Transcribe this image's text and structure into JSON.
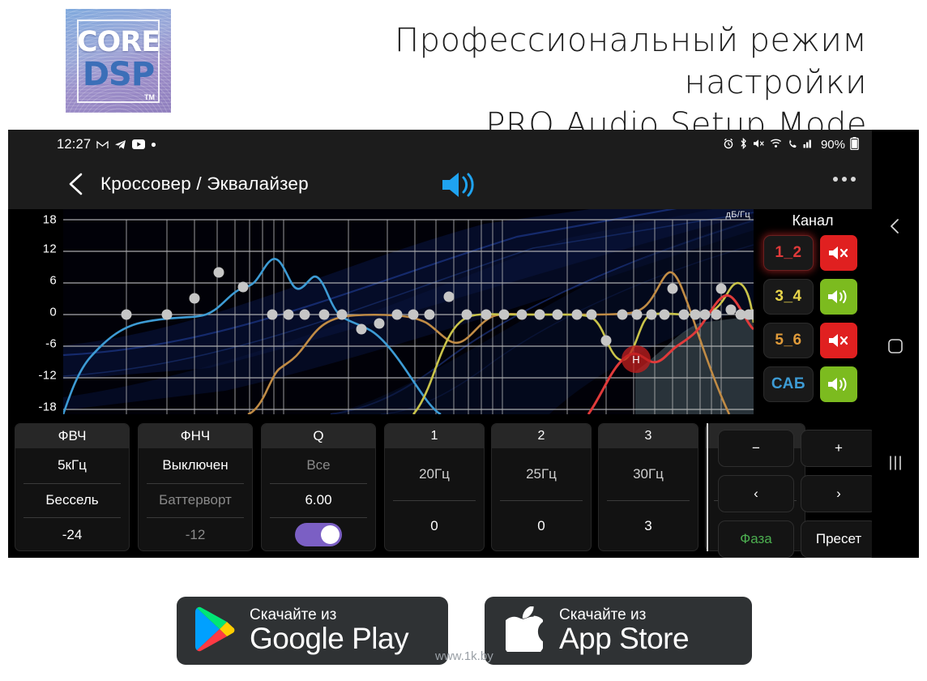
{
  "promo": {
    "logo": {
      "word1": "CORE",
      "word2": "DSP",
      "tm": "TM"
    },
    "title_ru": "Профессиональный режим настройки",
    "title_en": "PRO Audio Setup Mode"
  },
  "status_bar": {
    "clock": "12:27",
    "left_icons": [
      "gmail-icon",
      "telegram-icon",
      "youtube-icon",
      "dot-icon"
    ],
    "right_icons": [
      "alarm-icon",
      "bluetooth-icon",
      "mute-icon",
      "wifi-icon",
      "call-icon",
      "signal-icon"
    ],
    "battery_percent": "90%"
  },
  "title_bar": {
    "back_icon": "chevron-left-icon",
    "title": "Кроссовер / Эквалайзер",
    "speaker_icon": "speaker-on-icon",
    "overflow_icon": "overflow-menu-icon"
  },
  "graph": {
    "unit_label": "дБ/Гц",
    "y_ticks": [
      "18",
      "12",
      "6",
      "0",
      "-6",
      "-12",
      "-18"
    ],
    "marker_label": "H"
  },
  "chart_data": {
    "type": "line",
    "title": "Кроссовер / Эквалайзер",
    "xlabel": "Гц",
    "ylabel": "дБ",
    "ylim": [
      -18,
      18
    ],
    "xscale": "log",
    "grid": true,
    "legend": "none",
    "series": [
      {
        "name": "Канал 1_2",
        "color": "#3d9bd4",
        "points_db": [
          -18,
          -12,
          -4.5,
          -1.8,
          -1.6,
          -0.6,
          1.2,
          1.4,
          3.0,
          7.2,
          4.4,
          5.0,
          3.2,
          0.4,
          -1.0,
          -4.5,
          -9.0,
          -14.0,
          -18
        ]
      },
      {
        "name": "Канал 3_4",
        "color": "#c08b45",
        "points_db": [
          -18,
          -18,
          -17.5,
          -16.0,
          -13.5,
          -9.0,
          -4.0,
          -1.4,
          -0.4,
          0.0,
          0.0,
          -0.6,
          -3.4,
          -1.6,
          0.0,
          0.0,
          0.0,
          5.6,
          0.2,
          -3.0,
          -9.0,
          -16.0,
          -18
        ]
      },
      {
        "name": "Канал 5_6",
        "color": "#c9c34a",
        "points_db": [
          -18,
          -14.0,
          -6.0,
          -1.6,
          -0.2,
          0.0,
          0.0,
          0.0,
          -5.4,
          -0.2,
          0.0,
          0.0,
          0.0,
          4.6,
          0.4,
          -4.0,
          -10.0,
          -15.5,
          -17.5,
          -18
        ]
      },
      {
        "name": "САБ",
        "color": "#e03a3a",
        "points_db": [
          -18,
          -14.5,
          -8.5,
          -6.2,
          -6.6,
          -5.2,
          -3.2,
          0.0,
          4.2,
          1.4,
          -0.8,
          -1.2,
          -1.2
        ]
      }
    ],
    "node_gains_db": [
      0,
      0,
      3,
      7,
      4,
      0,
      0,
      0,
      0,
      0,
      0,
      -3,
      -1,
      0,
      0,
      0,
      3,
      0,
      0,
      0,
      0,
      0,
      0,
      0,
      0,
      -5,
      0,
      0,
      0,
      0,
      0,
      4,
      0,
      0,
      0,
      0,
      0,
      0,
      4,
      0,
      0,
      0,
      0
    ]
  },
  "channels": {
    "header": "Канал",
    "items": [
      {
        "label": "1_2",
        "color": "#e03a3a",
        "selected": true,
        "muted": true,
        "mute_icon": "speaker-muted-icon"
      },
      {
        "label": "3_4",
        "color": "#e8d44a",
        "selected": false,
        "muted": false,
        "mute_icon": "speaker-on-icon"
      },
      {
        "label": "5_6",
        "color": "#e09b3a",
        "selected": false,
        "muted": true,
        "mute_icon": "speaker-muted-icon"
      },
      {
        "label": "САБ",
        "color": "#3d9bd4",
        "selected": false,
        "muted": false,
        "mute_icon": "speaker-on-icon"
      }
    ]
  },
  "filters": [
    {
      "title": "ФВЧ",
      "freq": "5кГц",
      "freq_dim": false,
      "type": "Бессель",
      "type_dim": false,
      "slope": "-24",
      "slope_dim": false
    },
    {
      "title": "ФНЧ",
      "freq": "Выключен",
      "freq_dim": false,
      "type": "Баттерворт",
      "type_dim": true,
      "slope": "-12",
      "slope_dim": true
    }
  ],
  "q_card": {
    "title": "Q",
    "scope": "Все",
    "value": "6.00",
    "toggle_on": true
  },
  "bands": [
    {
      "index": "1",
      "freq": "20Гц",
      "gain": "0"
    },
    {
      "index": "2",
      "freq": "25Гц",
      "gain": "0"
    },
    {
      "index": "3",
      "freq": "30Гц",
      "gain": "3"
    },
    {
      "index": "",
      "freq": "",
      "gain": ""
    }
  ],
  "pad": {
    "minus": "−",
    "plus": "+",
    "prev": "‹",
    "next": "›",
    "phase": "Фаза",
    "preset": "Пресет"
  },
  "nav_bar": {
    "back": "back-icon",
    "home": "home-icon",
    "recents": "recents-icon"
  },
  "store_badges": [
    {
      "sub": "Скачайте из",
      "name": "Google Play",
      "icon": "google-play-icon"
    },
    {
      "sub": "Скачайте из",
      "name": "App Store",
      "icon": "apple-icon"
    }
  ],
  "watermark": "www.1k.by",
  "colors": {
    "accent_blue": "#1fa3f0",
    "toggle_purple": "#7b5fc4",
    "mute_red": "#e02020",
    "unmute_green": "#7cbb1f",
    "phase_green": "#4caf50"
  }
}
